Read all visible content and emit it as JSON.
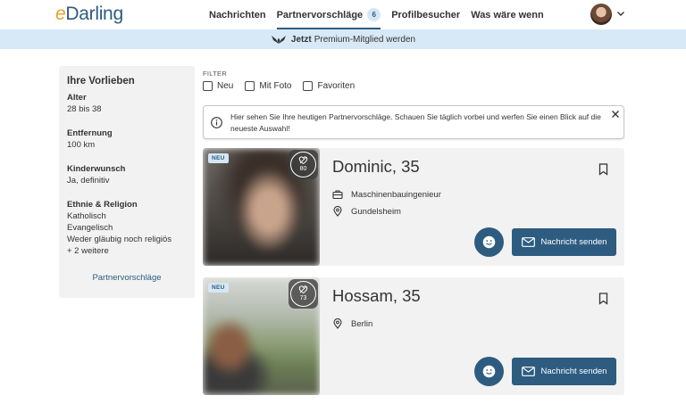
{
  "header": {
    "logo_prefix": "e",
    "logo_rest": "Darling",
    "nav": [
      {
        "label": "Nachrichten"
      },
      {
        "label": "Partnervorschläge",
        "badge": "6"
      },
      {
        "label": "Profilbesucher"
      },
      {
        "label": "Was wäre wenn"
      }
    ]
  },
  "premium": {
    "bold": "Jetzt",
    "rest": "Premium-Mitglied werden"
  },
  "sidebar": {
    "title": "Ihre Vorlieben",
    "age_label": "Alter",
    "age_value": "28 bis 38",
    "distance_label": "Entfernung",
    "distance_value": "100 km",
    "children_label": "Kinderwunsch",
    "children_value": "Ja, definitiv",
    "religion_label": "Ethnie & Religion",
    "religion_values": [
      "Katholisch",
      "Evangelisch",
      "Weder gläubig noch religiös",
      "+ 2 weitere"
    ],
    "link": "Partnervorschläge"
  },
  "filter": {
    "title": "FILTER",
    "options": [
      "Neu",
      "Mit Foto",
      "Favoriten"
    ]
  },
  "info": {
    "text": "Hier sehen Sie Ihre heutigen Partnervorschläge. Schauen Sie täglich vorbei und werfen Sie einen Blick auf die neueste Auswahl!"
  },
  "cards": [
    {
      "badge": "NEU",
      "match": "80",
      "name": "Dominic, 35",
      "job": "Maschinenbauingenieur",
      "location": "Gundelsheim",
      "message_label": "Nachricht senden"
    },
    {
      "badge": "NEU",
      "match": "73",
      "name": "Hossam, 35",
      "location": "Berlin",
      "message_label": "Nachricht senden"
    }
  ],
  "colors": {
    "brand": "#2d5c80",
    "accent": "#e7a02f",
    "banner": "#d7e9f7",
    "card": "#f2f2f2"
  }
}
